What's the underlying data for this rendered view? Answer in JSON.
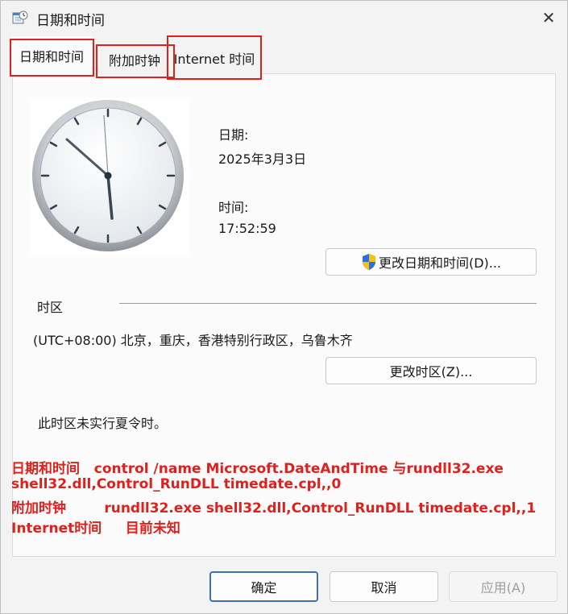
{
  "window": {
    "title": "日期和时间"
  },
  "tabs": [
    {
      "label": "日期和时间"
    },
    {
      "label": "附加时钟"
    },
    {
      "label": "Internet 时间"
    }
  ],
  "datetime": {
    "date_label": "日期:",
    "date_value": "2025年3月3日",
    "time_label": "时间:",
    "time_value": "17:52:59",
    "change_button": "更改日期和时间(D)..."
  },
  "timezone": {
    "section_label": "时区",
    "value": "(UTC+08:00) 北京，重庆，香港特别行政区，乌鲁木齐",
    "change_button": "更改时区(Z)...",
    "dst_note": "此时区未实行夏令时。"
  },
  "notes": [
    "日期和时间   control /name Microsoft.DateAndTime 与rundll32.exe",
    "shell32.dll,Control_RunDLL timedate.cpl,,0",
    "附加时钟        rundll32.exe shell32.dll,Control_RunDLL timedate.cpl,,1",
    "Internet时间     目前未知"
  ],
  "footer": {
    "ok": "确定",
    "cancel": "取消",
    "apply": "应用(A)"
  },
  "colors": {
    "annotation": "#e0201c",
    "primary_border": "#3e6fb8"
  },
  "icons": {
    "app": "calendar-clock-icon",
    "close": "close-icon",
    "shield": "uac-shield-icon"
  }
}
